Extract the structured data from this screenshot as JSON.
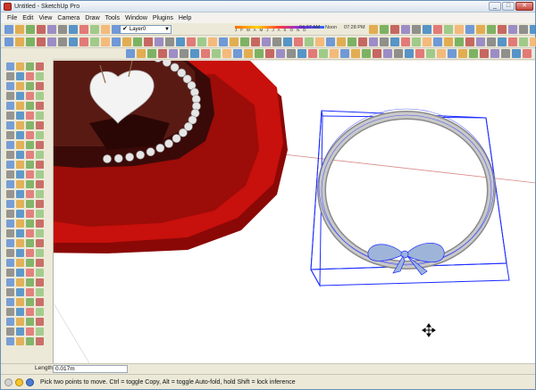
{
  "window": {
    "title": "Untitled - SketchUp Pro",
    "buttons": [
      "_",
      "□",
      "✕"
    ]
  },
  "menu": {
    "items": [
      "File",
      "Edit",
      "View",
      "Camera",
      "Draw",
      "Tools",
      "Window",
      "Plugins",
      "Help"
    ]
  },
  "toolbar": {
    "layer_value": "Layer0",
    "shadow_months": "J F M A M J J A S O N D",
    "shadow_time_left": "04:37 AM",
    "noon_label": "Noon",
    "shadow_time_right": "07:28 PM"
  },
  "measurements": {
    "label": "Length",
    "value": "0.017m"
  },
  "status": {
    "message": "Pick two points to move.  Ctrl = toggle Copy, Alt = toggle Auto-fold, hold Shift = lock inference"
  },
  "colors": {
    "cake_plate": "#c8100c",
    "cake_body": "#3a0a08",
    "pearl": "#e6e6e6",
    "selection": "#1c2cff",
    "ribbon": "#9eb4d8",
    "axis_red": "#d98a8a"
  },
  "icons": {
    "app": "sketchup-icon",
    "move_cursor": "move-cursor-icon",
    "status": "info-icon"
  }
}
